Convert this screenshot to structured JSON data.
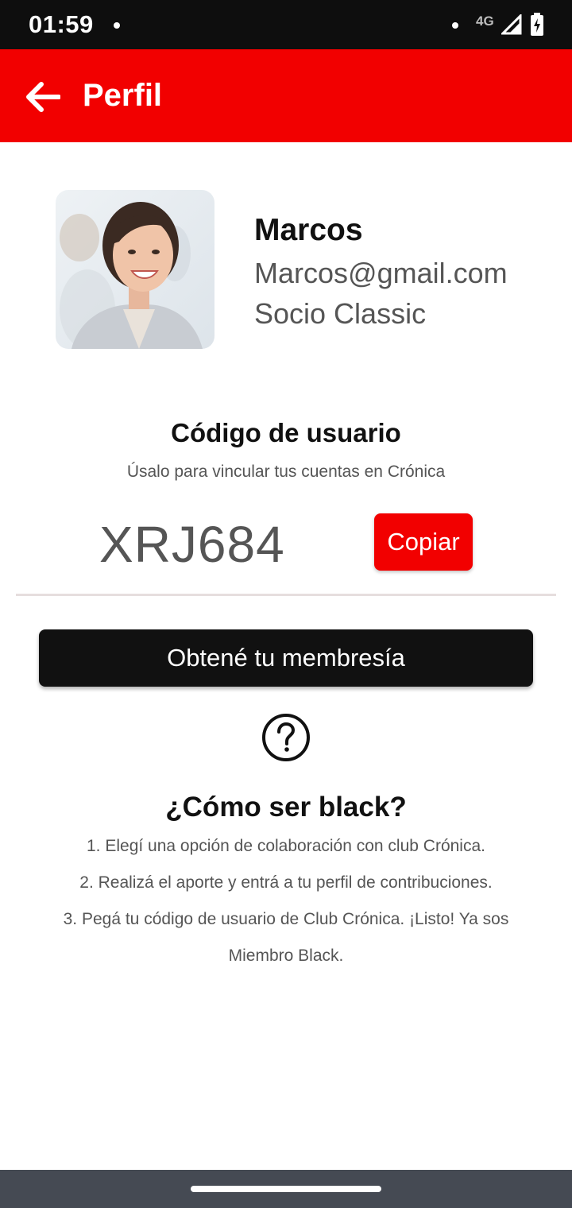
{
  "status_bar": {
    "time": "01:59",
    "network": "4G"
  },
  "app_bar": {
    "title": "Perfil",
    "back_icon": "arrow-left-icon",
    "color": "#f20000"
  },
  "profile": {
    "name": "Marcos",
    "email": "Marcos@gmail.com",
    "plan": "Socio Classic",
    "avatar_icon": "profile-photo"
  },
  "user_code": {
    "title": "Código de usuario",
    "subtitle": "Úsalo para vincular tus cuentas en Crónica",
    "code": "XRJ684",
    "copy_label": "Copiar"
  },
  "membership": {
    "button_label": "Obtené tu membresía"
  },
  "help": {
    "icon": "question-circle-icon",
    "title": "¿Cómo ser black?",
    "steps": [
      "1. Elegí una opción de colaboración con club Crónica.",
      "2. Realizá el aporte y entrá a tu perfil de contribuciones.",
      "3. Pegá tu código de usuario de Club Crónica. ¡Listo! Ya sos Miembro Black."
    ]
  }
}
